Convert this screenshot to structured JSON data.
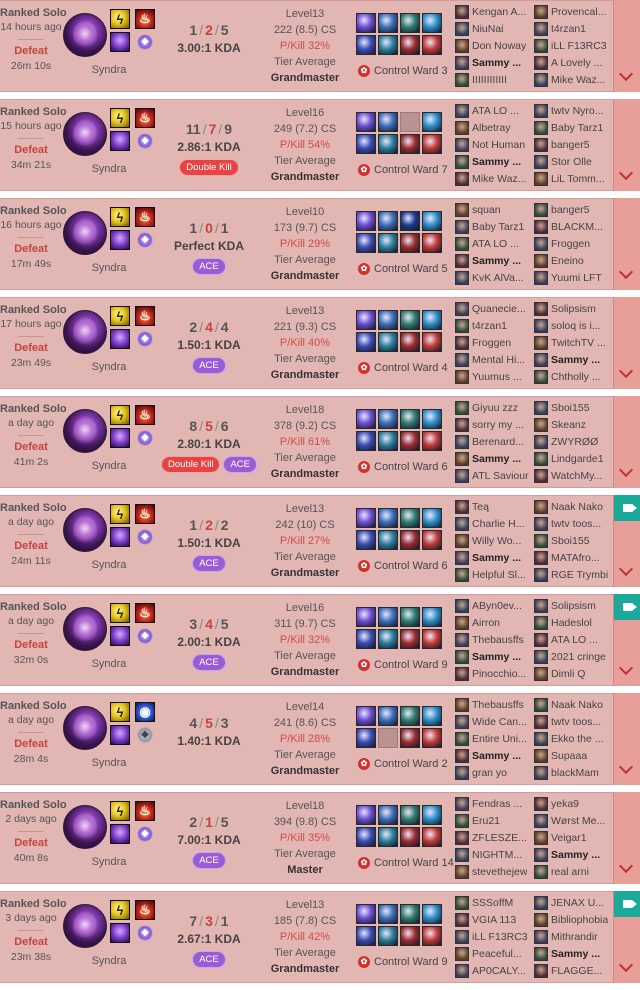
{
  "colors": {
    "card_bg": "#e2b6b3",
    "defeat": "#c6443e",
    "pkill": "#d34a43",
    "ace": "#9b5bd6",
    "multikill": "#e84343",
    "video": "#1ba99a"
  },
  "icons": {
    "champion": "syndra-portrait-icon",
    "spell_flash": "flash-spell-icon",
    "spell_ignite": "ignite-spell-icon",
    "spell_barrier": "barrier-spell-icon",
    "rune": "keystone-rune-icon",
    "ward": "control-ward-icon",
    "video": "video-camera-icon",
    "expand": "chevron-down-icon"
  },
  "games": [
    {
      "queue": "Ranked Solo",
      "ago": "14 hours ago",
      "result": "Defeat",
      "duration": "26m 10s",
      "champion": "Syndra",
      "spell2": "ignite",
      "subrune": "domination",
      "k": "1",
      "d": "2",
      "a": "5",
      "kda": "3.00:1 KDA",
      "badges": [],
      "level": "Level13",
      "cs": "222 (8.5) CS",
      "pkill": "P/Kill 32%",
      "tier_label": "Tier Average",
      "tier": "Grandmaster",
      "items": [
        "#6b4ed1",
        "#3b6fb6",
        "#2f7d6d",
        "#2b8fc7",
        "#3a4db3",
        "#2a7f9a",
        "#9c2d2d",
        "#c23b35"
      ],
      "ward": "Control Ward 3",
      "video": false,
      "team1": [
        "Kengan A...",
        "NiuNai",
        "Don Noway",
        "Sammy ...",
        "IIIIIIIIIIII"
      ],
      "team2": [
        "Provencal...",
        "t4rzan1",
        "iLL F13RC3",
        "A Lovely ...",
        "Mike Waz..."
      ]
    },
    {
      "queue": "Ranked Solo",
      "ago": "15 hours ago",
      "result": "Defeat",
      "duration": "34m 21s",
      "champion": "Syndra",
      "spell2": "ignite",
      "subrune": "domination",
      "k": "11",
      "d": "7",
      "a": "9",
      "kda": "2.86:1 KDA",
      "badges": [
        "Double Kill"
      ],
      "level": "Level16",
      "cs": "249 (7.2) CS",
      "pkill": "P/Kill 54%",
      "tier_label": "Tier Average",
      "tier": "Grandmaster",
      "items": [
        "#6b4ed1",
        "#3b6fb6",
        "",
        "#2b8fc7",
        "#3a4db3",
        "#2a7f9a",
        "#9c2d2d",
        "#c23b35"
      ],
      "ward": "Control Ward 7",
      "video": false,
      "team1": [
        "ATA LO ...",
        "Albetray",
        "Not Human",
        "Sammy ...",
        "Mike Waz..."
      ],
      "team2": [
        "twtv Nyro...",
        "Baby Tarz1",
        "banger5",
        "Stor Olle",
        "LiL Tomm..."
      ]
    },
    {
      "queue": "Ranked Solo",
      "ago": "16 hours ago",
      "result": "Defeat",
      "duration": "17m 49s",
      "champion": "Syndra",
      "spell2": "ignite",
      "subrune": "domination",
      "k": "1",
      "d": "0",
      "a": "1",
      "kda": "Perfect KDA",
      "badges": [
        "ACE"
      ],
      "level": "Level10",
      "cs": "173 (9.7) CS",
      "pkill": "P/Kill 29%",
      "tier_label": "Tier Average",
      "tier": "Grandmaster",
      "items": [
        "#6b4ed1",
        "#3b6fb6",
        "#1b3b8f",
        "#2b8fc7",
        "#3a4db3",
        "#2a7f9a",
        "#9c2d2d",
        "#c23b35"
      ],
      "ward": "Control Ward 5",
      "video": false,
      "team1": [
        "squan",
        "Baby Tarz1",
        "ATA LO ...",
        "Sammy ...",
        "KvK AlVa..."
      ],
      "team2": [
        "banger5",
        "BLACKM...",
        "Froggen",
        "Eneino",
        "Yuumi LFT"
      ]
    },
    {
      "queue": "Ranked Solo",
      "ago": "17 hours ago",
      "result": "Defeat",
      "duration": "23m 49s",
      "champion": "Syndra",
      "spell2": "ignite",
      "subrune": "domination",
      "k": "2",
      "d": "4",
      "a": "4",
      "kda": "1.50:1 KDA",
      "badges": [
        "ACE"
      ],
      "level": "Level13",
      "cs": "221 (9.3) CS",
      "pkill": "P/Kill 40%",
      "tier_label": "Tier Average",
      "tier": "Grandmaster",
      "items": [
        "#6b4ed1",
        "#3b6fb6",
        "#2f7d6d",
        "#2b8fc7",
        "#3a4db3",
        "#2a7f9a",
        "#9c2d2d",
        "#c23b35"
      ],
      "ward": "Control Ward 4",
      "video": false,
      "team1": [
        "Quanecie...",
        "t4rzan1",
        "Froggen",
        "Mental Hi...",
        "Yuumus ..."
      ],
      "team2": [
        "Solipsism",
        "soloq is i...",
        "TwitchTV ...",
        "Sammy ...",
        "Chtholly ..."
      ]
    },
    {
      "queue": "Ranked Solo",
      "ago": "a day ago",
      "result": "Defeat",
      "duration": "41m 2s",
      "champion": "Syndra",
      "spell2": "ignite",
      "subrune": "domination",
      "k": "8",
      "d": "5",
      "a": "6",
      "kda": "2.80:1 KDA",
      "badges": [
        "Double Kill",
        "ACE"
      ],
      "level": "Level18",
      "cs": "378 (9.2) CS",
      "pkill": "P/Kill 61%",
      "tier_label": "Tier Average",
      "tier": "Grandmaster",
      "items": [
        "#6b4ed1",
        "#3b6fb6",
        "#2f7d6d",
        "#2b8fc7",
        "#3a4db3",
        "#2a7f9a",
        "#9c2d2d",
        "#c23b35"
      ],
      "ward": "Control Ward 6",
      "video": false,
      "team1": [
        "Giyuu zzz",
        "sorry my ...",
        "Berenard...",
        "Sammy ...",
        "ATL Saviour"
      ],
      "team2": [
        "Sboi155",
        "Skeanz",
        "ZWYRØØ",
        "Lindgarde1",
        "WatchMy..."
      ]
    },
    {
      "queue": "Ranked Solo",
      "ago": "a day ago",
      "result": "Defeat",
      "duration": "24m 11s",
      "champion": "Syndra",
      "spell2": "ignite",
      "subrune": "domination",
      "k": "1",
      "d": "2",
      "a": "2",
      "kda": "1.50:1 KDA",
      "badges": [
        "ACE"
      ],
      "level": "Level13",
      "cs": "242 (10) CS",
      "pkill": "P/Kill 27%",
      "tier_label": "Tier Average",
      "tier": "Grandmaster",
      "items": [
        "#6b4ed1",
        "#3b6fb6",
        "#2f7d6d",
        "#2b8fc7",
        "#3a4db3",
        "#2a7f9a",
        "#9c2d2d",
        "#c23b35"
      ],
      "ward": "Control Ward 6",
      "video": true,
      "team1": [
        "Teą",
        "Charlie H...",
        "Willy Wo...",
        "Sammy ...",
        "Helpful Sl..."
      ],
      "team2": [
        "Naak Nako",
        "twtv toos...",
        "Sboi155",
        "MATAfro...",
        "RGE Trymbi"
      ]
    },
    {
      "queue": "Ranked Solo",
      "ago": "a day ago",
      "result": "Defeat",
      "duration": "32m 0s",
      "champion": "Syndra",
      "spell2": "ignite",
      "subrune": "domination",
      "k": "3",
      "d": "4",
      "a": "5",
      "kda": "2.00:1 KDA",
      "badges": [
        "ACE"
      ],
      "level": "Level16",
      "cs": "311 (9.7) CS",
      "pkill": "P/Kill 32%",
      "tier_label": "Tier Average",
      "tier": "Grandmaster",
      "items": [
        "#6b4ed1",
        "#3b6fb6",
        "#2f7d6d",
        "#2b8fc7",
        "#3a4db3",
        "#2a7f9a",
        "#9c2d2d",
        "#c23b35"
      ],
      "ward": "Control Ward 9",
      "video": true,
      "team1": [
        "AByn0ev...",
        "Airron",
        "Thebausffs",
        "Sammy ...",
        "Pinocchio..."
      ],
      "team2": [
        "Solipsism",
        "Hadeslol",
        "ATA LO ...",
        "2021 cringe",
        "Dimli Q"
      ]
    },
    {
      "queue": "Ranked Solo",
      "ago": "a day ago",
      "result": "Defeat",
      "duration": "28m 4s",
      "champion": "Syndra",
      "spell2": "barrier",
      "subrune": "sorcery",
      "k": "4",
      "d": "5",
      "a": "3",
      "kda": "1.40:1 KDA",
      "badges": [],
      "level": "Level14",
      "cs": "241 (8.6) CS",
      "pkill": "P/Kill 28%",
      "tier_label": "Tier Average",
      "tier": "Grandmaster",
      "items": [
        "#6b4ed1",
        "#3b6fb6",
        "#2f7d6d",
        "#2b8fc7",
        "#3a4db3",
        "",
        "#9c2d2d",
        "#c23b35"
      ],
      "ward": "Control Ward 2",
      "video": false,
      "team1": [
        "Thebausffs",
        "Wide Can...",
        "Entire Uni...",
        "Sammy ...",
        "gran yo"
      ],
      "team2": [
        "Naak Nako",
        "twtv toos...",
        "Ekko the ...",
        "Supaaa",
        "blackMam"
      ]
    },
    {
      "queue": "Ranked Solo",
      "ago": "2 days ago",
      "result": "Defeat",
      "duration": "40m 8s",
      "champion": "Syndra",
      "spell2": "ignite",
      "subrune": "domination",
      "k": "2",
      "d": "1",
      "a": "5",
      "kda": "7.00:1 KDA",
      "badges": [
        "ACE"
      ],
      "level": "Level18",
      "cs": "394 (9.8) CS",
      "pkill": "P/Kill 35%",
      "tier_label": "Tier Average",
      "tier": "Master",
      "items": [
        "#6b4ed1",
        "#3b6fb6",
        "#2f7d6d",
        "#2b8fc7",
        "#3a4db3",
        "#2a7f9a",
        "#9c2d2d",
        "#c23b35"
      ],
      "ward": "Control Ward 14",
      "video": false,
      "team1": [
        "Fendras ...",
        "Eru21",
        "ZFLESZE...",
        "NIGHTM...",
        "stevethejew"
      ],
      "team2": [
        "yeka9",
        "Wørst Me...",
        "Veigar1",
        "Sammy ...",
        "real arni"
      ]
    },
    {
      "queue": "Ranked Solo",
      "ago": "3 days ago",
      "result": "Defeat",
      "duration": "23m 38s",
      "champion": "Syndra",
      "spell2": "ignite",
      "subrune": "domination",
      "k": "7",
      "d": "3",
      "a": "1",
      "kda": "2.67:1 KDA",
      "badges": [
        "ACE"
      ],
      "level": "Level13",
      "cs": "185 (7.8) CS",
      "pkill": "P/Kill 42%",
      "tier_label": "Tier Average",
      "tier": "Grandmaster",
      "items": [
        "#6b4ed1",
        "#3b6fb6",
        "#2f7d6d",
        "#2b8fc7",
        "#3a4db3",
        "#2a7f9a",
        "#9c2d2d",
        "#c23b35"
      ],
      "ward": "Control Ward 9",
      "video": true,
      "team1": [
        "SSSoffM",
        "VGIA 113",
        "iLL F13RC3",
        "Peaceful...",
        "AP0CALY..."
      ],
      "team2": [
        "JENAX U...",
        "Bibliophobia",
        "Mithrandir",
        "Sammy ...",
        "FLAGGE..."
      ]
    }
  ]
}
